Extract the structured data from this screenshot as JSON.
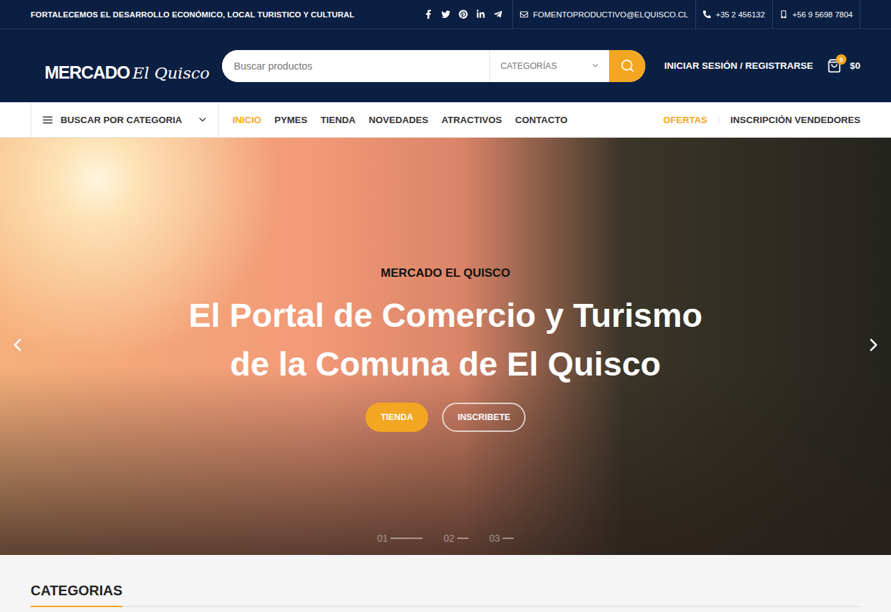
{
  "top_bar": {
    "tagline": "FORTALECEMOS EL DESARROLLO ECONÓMICO, LOCAL TURISTICO Y CULTURAL",
    "contacts": [
      {
        "kind": "email",
        "text": "FOMENTOPRODUCTIVO@ELQUISCO.CL"
      },
      {
        "kind": "phone",
        "text": "+35 2 456132"
      },
      {
        "kind": "mobile",
        "text": "+56 9 5698 7804"
      }
    ]
  },
  "logo": {
    "word1": "MERCADO",
    "word2": "El Quisco"
  },
  "search": {
    "placeholder": "Buscar productos",
    "category": "CATEGORÍAS"
  },
  "account": {
    "label": "INICIAR SESIÓN / REGISTRARSE"
  },
  "cart": {
    "count": "0",
    "total": "$0"
  },
  "nav": {
    "category_button": "BUSCAR POR CATEGORIA",
    "links": [
      {
        "label": "INICIO",
        "selected": true
      },
      {
        "label": "PYMES",
        "selected": false
      },
      {
        "label": "TIENDA",
        "selected": false
      },
      {
        "label": "NOVEDADES",
        "selected": false
      },
      {
        "label": "ATRACTIVOS",
        "selected": false
      },
      {
        "label": "CONTACTO",
        "selected": false
      }
    ],
    "extras": [
      {
        "label": "OFERTAS",
        "highlighted": true
      },
      {
        "label": "INSCRIPCIÓN VENDEDORES",
        "highlighted": false
      }
    ]
  },
  "hero": {
    "eyebrow": "MERCADO EL QUISCO",
    "title_lines": [
      "El Portal de Comercio y Turismo",
      "de la Comuna de El Quisco"
    ],
    "buttons": [
      {
        "label": "TIENDA",
        "kind": "filled"
      },
      {
        "label": "INSCRIBETE",
        "kind": "outline"
      }
    ],
    "slides": [
      {
        "label": "01",
        "selected": true
      },
      {
        "label": "02",
        "selected": false
      },
      {
        "label": "03",
        "selected": false
      }
    ]
  },
  "section": {
    "title": "CATEGORIAS"
  }
}
